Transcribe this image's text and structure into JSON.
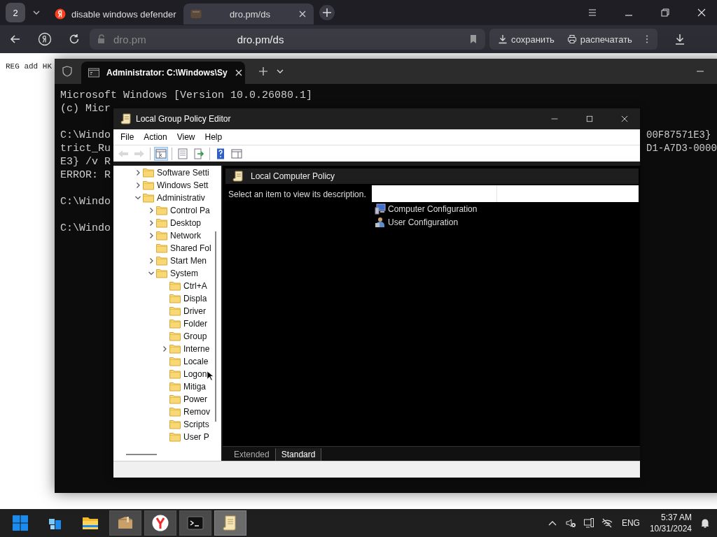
{
  "browser": {
    "tab_count": "2",
    "tabs": [
      {
        "title": "disable windows defender",
        "kind": "site",
        "selected": false
      },
      {
        "title": "dro.pm/ds",
        "kind": "page",
        "selected": true
      }
    ],
    "address": {
      "domain": "dro.pm",
      "url": "dro.pm/ds"
    },
    "actions": [
      {
        "label": "сохранить",
        "kind": "save"
      },
      {
        "label": "распечатать",
        "kind": "print"
      }
    ],
    "page_text": "REG add HK"
  },
  "terminal": {
    "tab_title": "Administrator: C:\\Windows\\Sy",
    "lines": [
      {
        "kind": "text",
        "left": "Microsoft Windows [Version 10.0.26080.1]"
      },
      {
        "kind": "text",
        "left": "(c) Micr"
      },
      {
        "kind": "blank"
      },
      {
        "kind": "text",
        "left": "C:\\Windo",
        "right": "00F87571E3}"
      },
      {
        "kind": "text",
        "left": "trict_Ru",
        "right": "D1-A7D3-0000"
      },
      {
        "kind": "text",
        "left": "E3} /v R"
      },
      {
        "kind": "text",
        "left": "ERROR: R"
      },
      {
        "kind": "blank"
      },
      {
        "kind": "text",
        "left": "C:\\Windo"
      },
      {
        "kind": "blank"
      },
      {
        "kind": "text",
        "left": "C:\\Windo"
      }
    ]
  },
  "gpe": {
    "title": "Local Group Policy Editor",
    "menu": [
      "File",
      "Action",
      "View",
      "Help"
    ],
    "toolbar": [
      {
        "kind": "back",
        "disabled": true,
        "pressed": false
      },
      {
        "kind": "forward",
        "disabled": true,
        "pressed": false
      },
      {
        "kind": "tree",
        "disabled": false,
        "pressed": true
      },
      {
        "kind": "properties",
        "disabled": false,
        "pressed": false
      },
      {
        "kind": "export",
        "disabled": false,
        "pressed": false
      },
      {
        "kind": "help",
        "disabled": false,
        "pressed": false
      },
      {
        "kind": "pane",
        "disabled": false,
        "pressed": false
      }
    ],
    "tree": [
      {
        "label": "Software Setti",
        "expanded": false
      },
      {
        "label": "Windows Sett",
        "expanded": false
      },
      {
        "label": "Administrativ",
        "expanded": true,
        "children": [
          {
            "label": "Control Pa",
            "expanded": false
          },
          {
            "label": "Desktop",
            "expanded": false
          },
          {
            "label": "Network",
            "expanded": false
          },
          {
            "label": "Shared Fol"
          },
          {
            "label": "Start Men",
            "expanded": false
          },
          {
            "label": "System",
            "expanded": true,
            "children": [
              {
                "label": "Ctrl+A"
              },
              {
                "label": "Displa"
              },
              {
                "label": "Driver"
              },
              {
                "label": "Folder"
              },
              {
                "label": "Group"
              },
              {
                "label": "Interne",
                "expanded": false
              },
              {
                "label": "Locale"
              },
              {
                "label": "Logon"
              },
              {
                "label": "Mitiga"
              },
              {
                "label": "Power"
              },
              {
                "label": "Remov"
              },
              {
                "label": "Scripts"
              },
              {
                "label": "User P"
              }
            ]
          }
        ]
      }
    ],
    "pane_title": "Local Computer Policy",
    "description": "Select an item to view its description.",
    "items": [
      {
        "label": "Computer Configuration",
        "kind": "computer"
      },
      {
        "label": "User Configuration",
        "kind": "user"
      }
    ],
    "view_tabs": [
      {
        "label": "Extended",
        "selected": false
      },
      {
        "label": "Standard",
        "selected": true
      }
    ]
  },
  "taskbar": {
    "apps": [
      {
        "kind": "start",
        "running": false,
        "selected": false
      },
      {
        "kind": "widgets",
        "running": false,
        "selected": false
      },
      {
        "kind": "explorer",
        "running": false,
        "selected": false
      },
      {
        "kind": "archive",
        "running": true,
        "selected": false
      },
      {
        "kind": "browser",
        "running": true,
        "selected": false
      },
      {
        "kind": "terminal",
        "running": true,
        "selected": false
      },
      {
        "kind": "policy",
        "running": true,
        "selected": true
      }
    ],
    "language": "ENG",
    "time": "5:37 AM",
    "date": "10/31/2024"
  }
}
